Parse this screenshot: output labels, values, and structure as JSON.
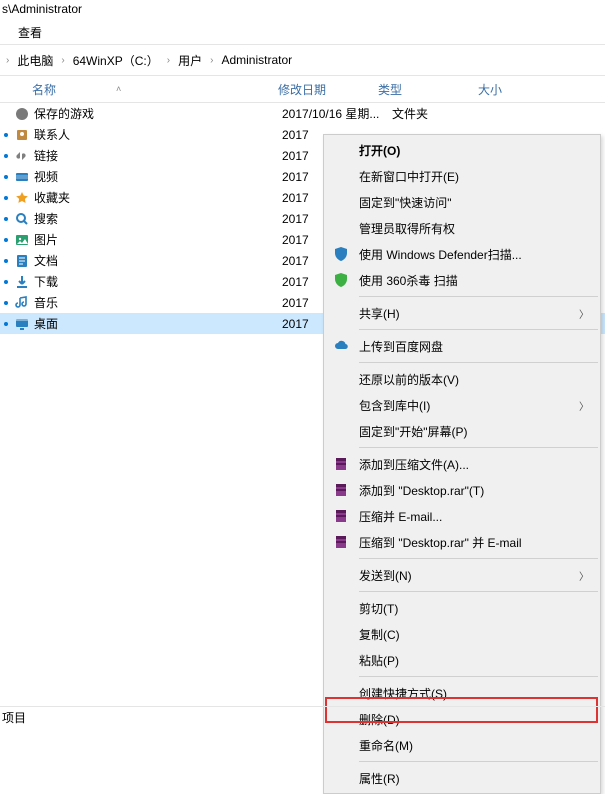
{
  "titlebar": {
    "path": "s\\Administrator"
  },
  "menubar": {
    "view": "查看"
  },
  "breadcrumb": {
    "items": [
      "此电脑",
      "64WinXP（C:）",
      "用户",
      "Administrator"
    ]
  },
  "columns": {
    "name": "名称",
    "date": "修改日期",
    "type": "类型",
    "size": "大小"
  },
  "rows": [
    {
      "marked": false,
      "icon": "game",
      "name": "保存的游戏",
      "date": "2017/10/16 星期...",
      "type": "文件夹"
    },
    {
      "marked": true,
      "icon": "contact",
      "name": "联系人",
      "date": "2017"
    },
    {
      "marked": true,
      "icon": "link",
      "name": "链接",
      "date": "2017"
    },
    {
      "marked": true,
      "icon": "video",
      "name": "视频",
      "date": "2017"
    },
    {
      "marked": true,
      "icon": "star",
      "name": "收藏夹",
      "date": "2017"
    },
    {
      "marked": true,
      "icon": "search",
      "name": "搜索",
      "date": "2017"
    },
    {
      "marked": true,
      "icon": "picture",
      "name": "图片",
      "date": "2017"
    },
    {
      "marked": true,
      "icon": "doc",
      "name": "文档",
      "date": "2017"
    },
    {
      "marked": true,
      "icon": "down",
      "name": "下载",
      "date": "2017"
    },
    {
      "marked": true,
      "icon": "music",
      "name": "音乐",
      "date": "2017"
    },
    {
      "marked": true,
      "icon": "desktop",
      "name": "桌面",
      "date": "2017",
      "selected": true
    }
  ],
  "context": {
    "g0": [
      {
        "label": "打开(O)",
        "bold": true
      },
      {
        "label": "在新窗口中打开(E)"
      },
      {
        "label": "固定到\"快速访问\""
      },
      {
        "label": "管理员取得所有权"
      },
      {
        "label": "使用 Windows Defender扫描...",
        "icon": "shield-blue"
      },
      {
        "label": "使用 360杀毒 扫描",
        "icon": "shield-green"
      }
    ],
    "g1": [
      {
        "label": "共享(H)",
        "sub": true
      }
    ],
    "g2": [
      {
        "label": "上传到百度网盘",
        "icon": "cloud"
      }
    ],
    "g3": [
      {
        "label": "还原以前的版本(V)"
      },
      {
        "label": "包含到库中(I)",
        "sub": true
      },
      {
        "label": "固定到\"开始\"屏幕(P)"
      }
    ],
    "g4": [
      {
        "label": "添加到压缩文件(A)...",
        "icon": "rar"
      },
      {
        "label": "添加到 \"Desktop.rar\"(T)",
        "icon": "rar"
      },
      {
        "label": "压缩并 E-mail...",
        "icon": "rar"
      },
      {
        "label": "压缩到 \"Desktop.rar\" 并 E-mail",
        "icon": "rar"
      }
    ],
    "g5": [
      {
        "label": "发送到(N)",
        "sub": true
      }
    ],
    "g6": [
      {
        "label": "剪切(T)"
      },
      {
        "label": "复制(C)"
      },
      {
        "label": "粘贴(P)"
      }
    ],
    "g7": [
      {
        "label": "创建快捷方式(S)"
      },
      {
        "label": "删除(D)"
      },
      {
        "label": "重命名(M)"
      }
    ],
    "g8": [
      {
        "label": "属性(R)"
      }
    ]
  },
  "status": {
    "text": "项目"
  }
}
